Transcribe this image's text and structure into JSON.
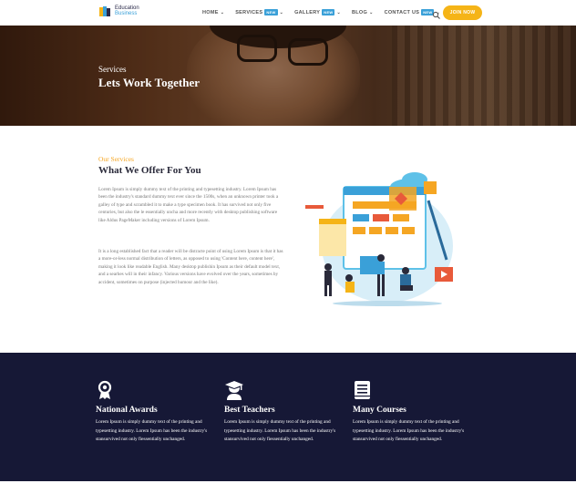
{
  "brand": {
    "line1": "Education",
    "line2": "Business"
  },
  "nav": {
    "items": [
      {
        "label": "HOME",
        "badge": ""
      },
      {
        "label": "SERVICES",
        "badge": "NEW"
      },
      {
        "label": "GALLERY",
        "badge": "NEW"
      },
      {
        "label": "BLOG",
        "badge": ""
      },
      {
        "label": "CONTACT US",
        "badge": "NEW"
      }
    ],
    "cta_label": "JOIN NOW",
    "search_icon": "search-icon",
    "accent": "#f5b417",
    "badge_color": "#3aa0d8"
  },
  "hero": {
    "label": "Services",
    "title": "Lets Work Together"
  },
  "services": {
    "label": "Our Services",
    "title": "What We Offer For You",
    "p1": "Lorem Ipsum is simply dummy text of the printing and typesetting industry. Lorem Ipsum has been the industry's standard dummy text ever since the 1500s, when an unknown printer took a galley of type and scrambled it to make a type specimen book. It has survived not only five centuries, but also the le essentially uncha and more recently with desktop publishing software like Aldus PageMaker including versions of Lorem Ipsum.",
    "p2": "It is a long established fact that a reader will be distracte point of using Lorem Ipsum is that it has a more-or-less normal distribution of letters, as opposed to using 'Content here, content here', making it look like readable English. Many desktop publishin Ipsum as their default model text, and a searhes will in their infancy. Various versions have evolved over the years, sometimes by accident, sometimes on purpose (injected humour and the like)."
  },
  "features": {
    "background": "#161836",
    "items": [
      {
        "icon": "award-ribbon-icon",
        "title": "National Awards",
        "text": "Lorem Ipsum is simply dummy text of the printing and typesetting industry. Lorem Ipsum has been the industry's stansurvived not only fiessentially unchanged."
      },
      {
        "icon": "teacher-graduation-icon",
        "title": "Best Teachers",
        "text": "Lorem Ipsum is simply dummy text of the printing and typesetting industry. Lorem Ipsum has been the industry's stansurvived not only fiessentially unchanged."
      },
      {
        "icon": "book-icon",
        "title": "Many Courses",
        "text": "Lorem Ipsum is simply dummy text of the printing and typesetting industry. Lorem Ipsum has been the industry's stansurvived not only fiessentially unchanged."
      }
    ]
  }
}
